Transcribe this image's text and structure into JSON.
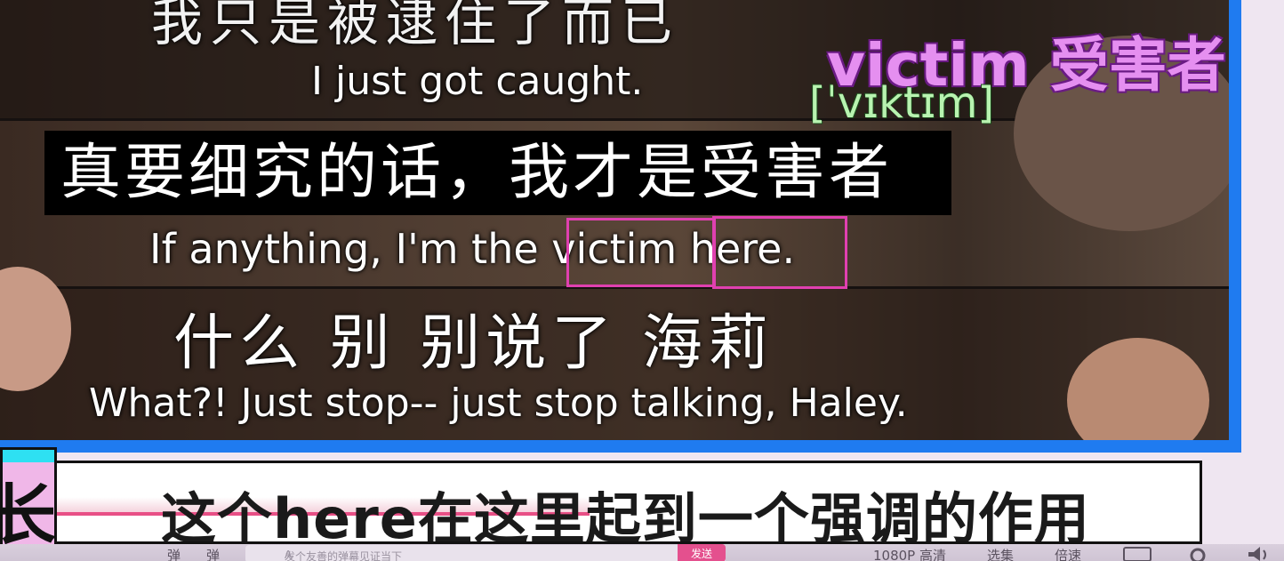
{
  "video": {
    "subtitle_top_zh": "我只是被逮住了而已",
    "subtitle_top_en": "I just got caught.",
    "subtitle_main_zh": "真要细究的话，我才是受害者",
    "subtitle_main_en": "If anything, I'm the victim here.",
    "subtitle_third_zh": "什么 别 别说了 海莉",
    "subtitle_third_en": "What?! Just stop-- just stop talking, Haley."
  },
  "vocab": {
    "word": "victim 受害者",
    "ipa": "[ˈvɪktɪm]"
  },
  "caption": {
    "text": "这个here在这里起到一个强调的作用",
    "badge": "长"
  },
  "controls": {
    "danmaku_icon_1": "弹",
    "danmaku_icon_2": "弹",
    "input_icon": "A",
    "input_placeholder": "发个友善的弹幕见证当下",
    "send_label": "发送",
    "quality_label": "1080P 高清",
    "episodes_label": "选集",
    "speed_label": "倍速"
  },
  "colors": {
    "accent_blue": "#1f7bf0",
    "highlight_pink": "#e040b0",
    "send_pink": "#e4508e"
  }
}
